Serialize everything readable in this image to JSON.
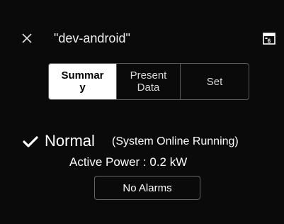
{
  "status_bar": {
    "left_text": "",
    "right_text": ""
  },
  "header": {
    "title": "\"dev-android\""
  },
  "tabs": [
    {
      "label": "Summar\ny",
      "active": true
    },
    {
      "label": "Present\nData",
      "active": false
    },
    {
      "label": "Set",
      "active": false
    }
  ],
  "system_status": {
    "state": "Normal",
    "detail": "(System Online Running)"
  },
  "power": {
    "text": "Active Power : 0.2 kW"
  },
  "alarms_button": {
    "label": "No Alarms"
  },
  "icons": {
    "close": "close-icon",
    "calendar": "calendar-icon",
    "status": "check-icon"
  },
  "colors": {
    "background": "#0a0a0a",
    "text": "#ffffff",
    "active_tab_bg": "#ffffff",
    "border": "#5a5a5a"
  }
}
